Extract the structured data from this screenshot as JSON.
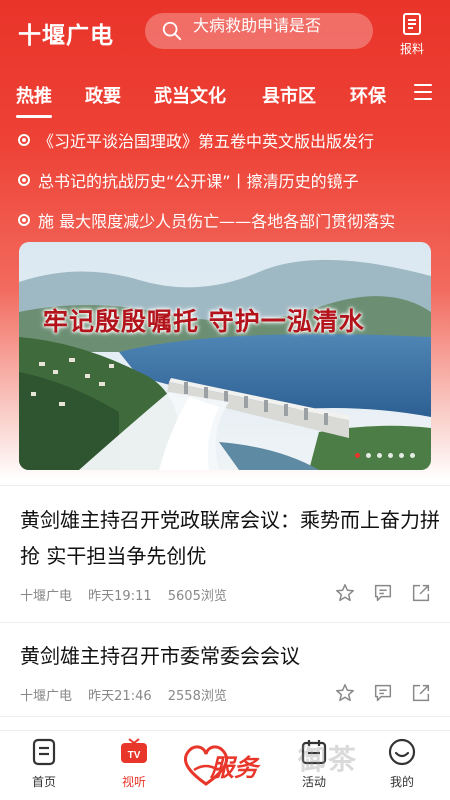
{
  "header": {
    "logo": "十堰广电",
    "search_text": "大病救助申请是否",
    "report_label": "报料"
  },
  "tabs": [
    {
      "label": "热推",
      "active": true
    },
    {
      "label": "政要",
      "active": false
    },
    {
      "label": "武当文化",
      "active": false
    },
    {
      "label": "县市区",
      "active": false
    },
    {
      "label": "环保",
      "active": false
    }
  ],
  "ticker": [
    "《习近平谈治国理政》第五卷中英文版出版发行",
    "总书记的抗战历史“公开课”丨擦清历史的镜子",
    "施 最大限度减少人员伤亡——各地各部门贯彻落实"
  ],
  "banner": {
    "caption": "牢记殷殷嘱托  守护一泓清水",
    "slides": 6,
    "active_slide": 0
  },
  "news": [
    {
      "title": "黄剑雄主持召开党政联席会议：乘势而上奋力拼抢 实干担当争先创优",
      "source": "十堰广电",
      "time": "昨天19:11",
      "views": "5605浏览"
    },
    {
      "title": "黄剑雄主持召开市委常委会会议",
      "source": "十堰广电",
      "time": "昨天21:46",
      "views": "2558浏览"
    }
  ],
  "bottom_nav": {
    "home": "首页",
    "video": "视听",
    "service": "服务",
    "activity": "活动",
    "mine": "我的"
  },
  "watermark": "御茶",
  "colors": {
    "brand": "#e8362a",
    "header_top": "#e9342a"
  }
}
